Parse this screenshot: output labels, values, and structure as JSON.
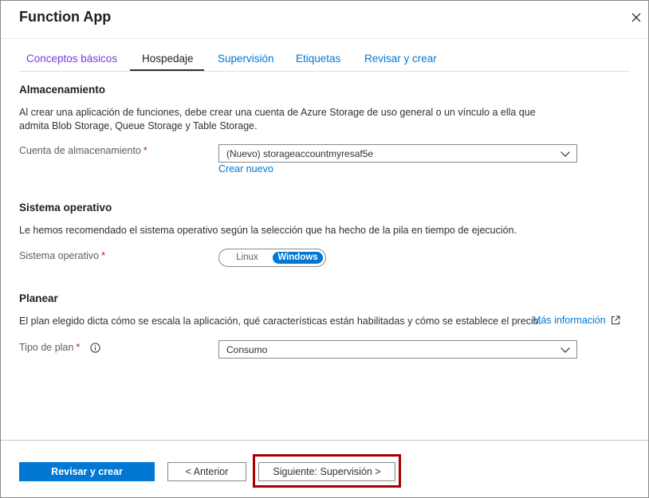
{
  "window": {
    "title": "Function App",
    "close_icon": "close-icon"
  },
  "tabs": [
    {
      "label": "Conceptos básicos",
      "state": "visited"
    },
    {
      "label": "Hospedaje",
      "state": "active"
    },
    {
      "label": "Supervisión",
      "state": "link"
    },
    {
      "label": "Etiquetas",
      "state": "link"
    },
    {
      "label": "Revisar y crear",
      "state": "link"
    }
  ],
  "storage": {
    "title": "Almacenamiento",
    "desc_line1": "Al crear una aplicación de funciones, debe crear una cuenta de Azure Storage de uso general o un vínculo a ella que",
    "desc_line2": "admita Blob Storage, Queue Storage y Table Storage.",
    "field_label": "Cuenta de almacenamiento",
    "required_mark": "*",
    "value": "(Nuevo) storageaccountmyresaf5e",
    "create_new": "Crear nuevo"
  },
  "os": {
    "title": "Sistema operativo",
    "desc": "Le hemos recomendado el sistema operativo según la selección que ha hecho de la pila en tiempo de ejecución.",
    "field_label": "Sistema operativo",
    "required_mark": "*",
    "options": [
      "Linux",
      "Windows"
    ],
    "selected": "Windows"
  },
  "plan": {
    "title": "Planear",
    "desc": "El plan elegido dicta cómo se escala la aplicación, qué características están habilitadas y cómo se establece el precio.",
    "more_info": "Más información",
    "field_label": "Tipo de plan",
    "required_mark": "*",
    "value": "Consumo"
  },
  "footer": {
    "review_create": "Revisar y crear",
    "previous": "< Anterior",
    "next": "Siguiente: Supervisión >"
  },
  "colors": {
    "accent": "#0078d4",
    "visited_tab": "#773adc",
    "required": "#a4262c",
    "highlight_border": "#a80000"
  }
}
